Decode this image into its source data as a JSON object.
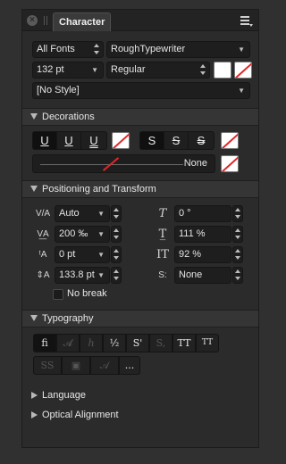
{
  "panel": {
    "tab_label": "Character",
    "close_glyph": "×"
  },
  "font": {
    "collection": "All Fonts",
    "family": "RoughTypewriter",
    "size": "132 pt",
    "style": "Regular",
    "paragraph_style": "[No Style]"
  },
  "decorations": {
    "title": "Decorations",
    "underline_buttons": [
      "U",
      "U",
      "U"
    ],
    "strike_buttons": [
      "S",
      "S",
      "S"
    ],
    "slider_value": "None"
  },
  "positioning": {
    "title": "Positioning and Transform",
    "kerning": "Auto",
    "tracking": "200 ‰",
    "baseline": "0 pt",
    "leading": "133.8 pt",
    "shear": "0 °",
    "horizontal_scale": "111 %",
    "vertical_scale": "92 %",
    "script": "None",
    "no_break_label": "No break"
  },
  "typography": {
    "title": "Typography",
    "row1": [
      "fi",
      "𝓐",
      "ℎ",
      "½",
      "S'",
      "S,",
      "TT",
      "TT"
    ],
    "row2": [
      "SS",
      "▣",
      "𝒜",
      "..."
    ]
  },
  "collapsed_sections": {
    "language": "Language",
    "optical_alignment": "Optical Alignment"
  },
  "colors": {
    "panel_bg": "#2b2b2b",
    "field_bg": "#1e1e1e",
    "none_red": "#e0262a"
  }
}
